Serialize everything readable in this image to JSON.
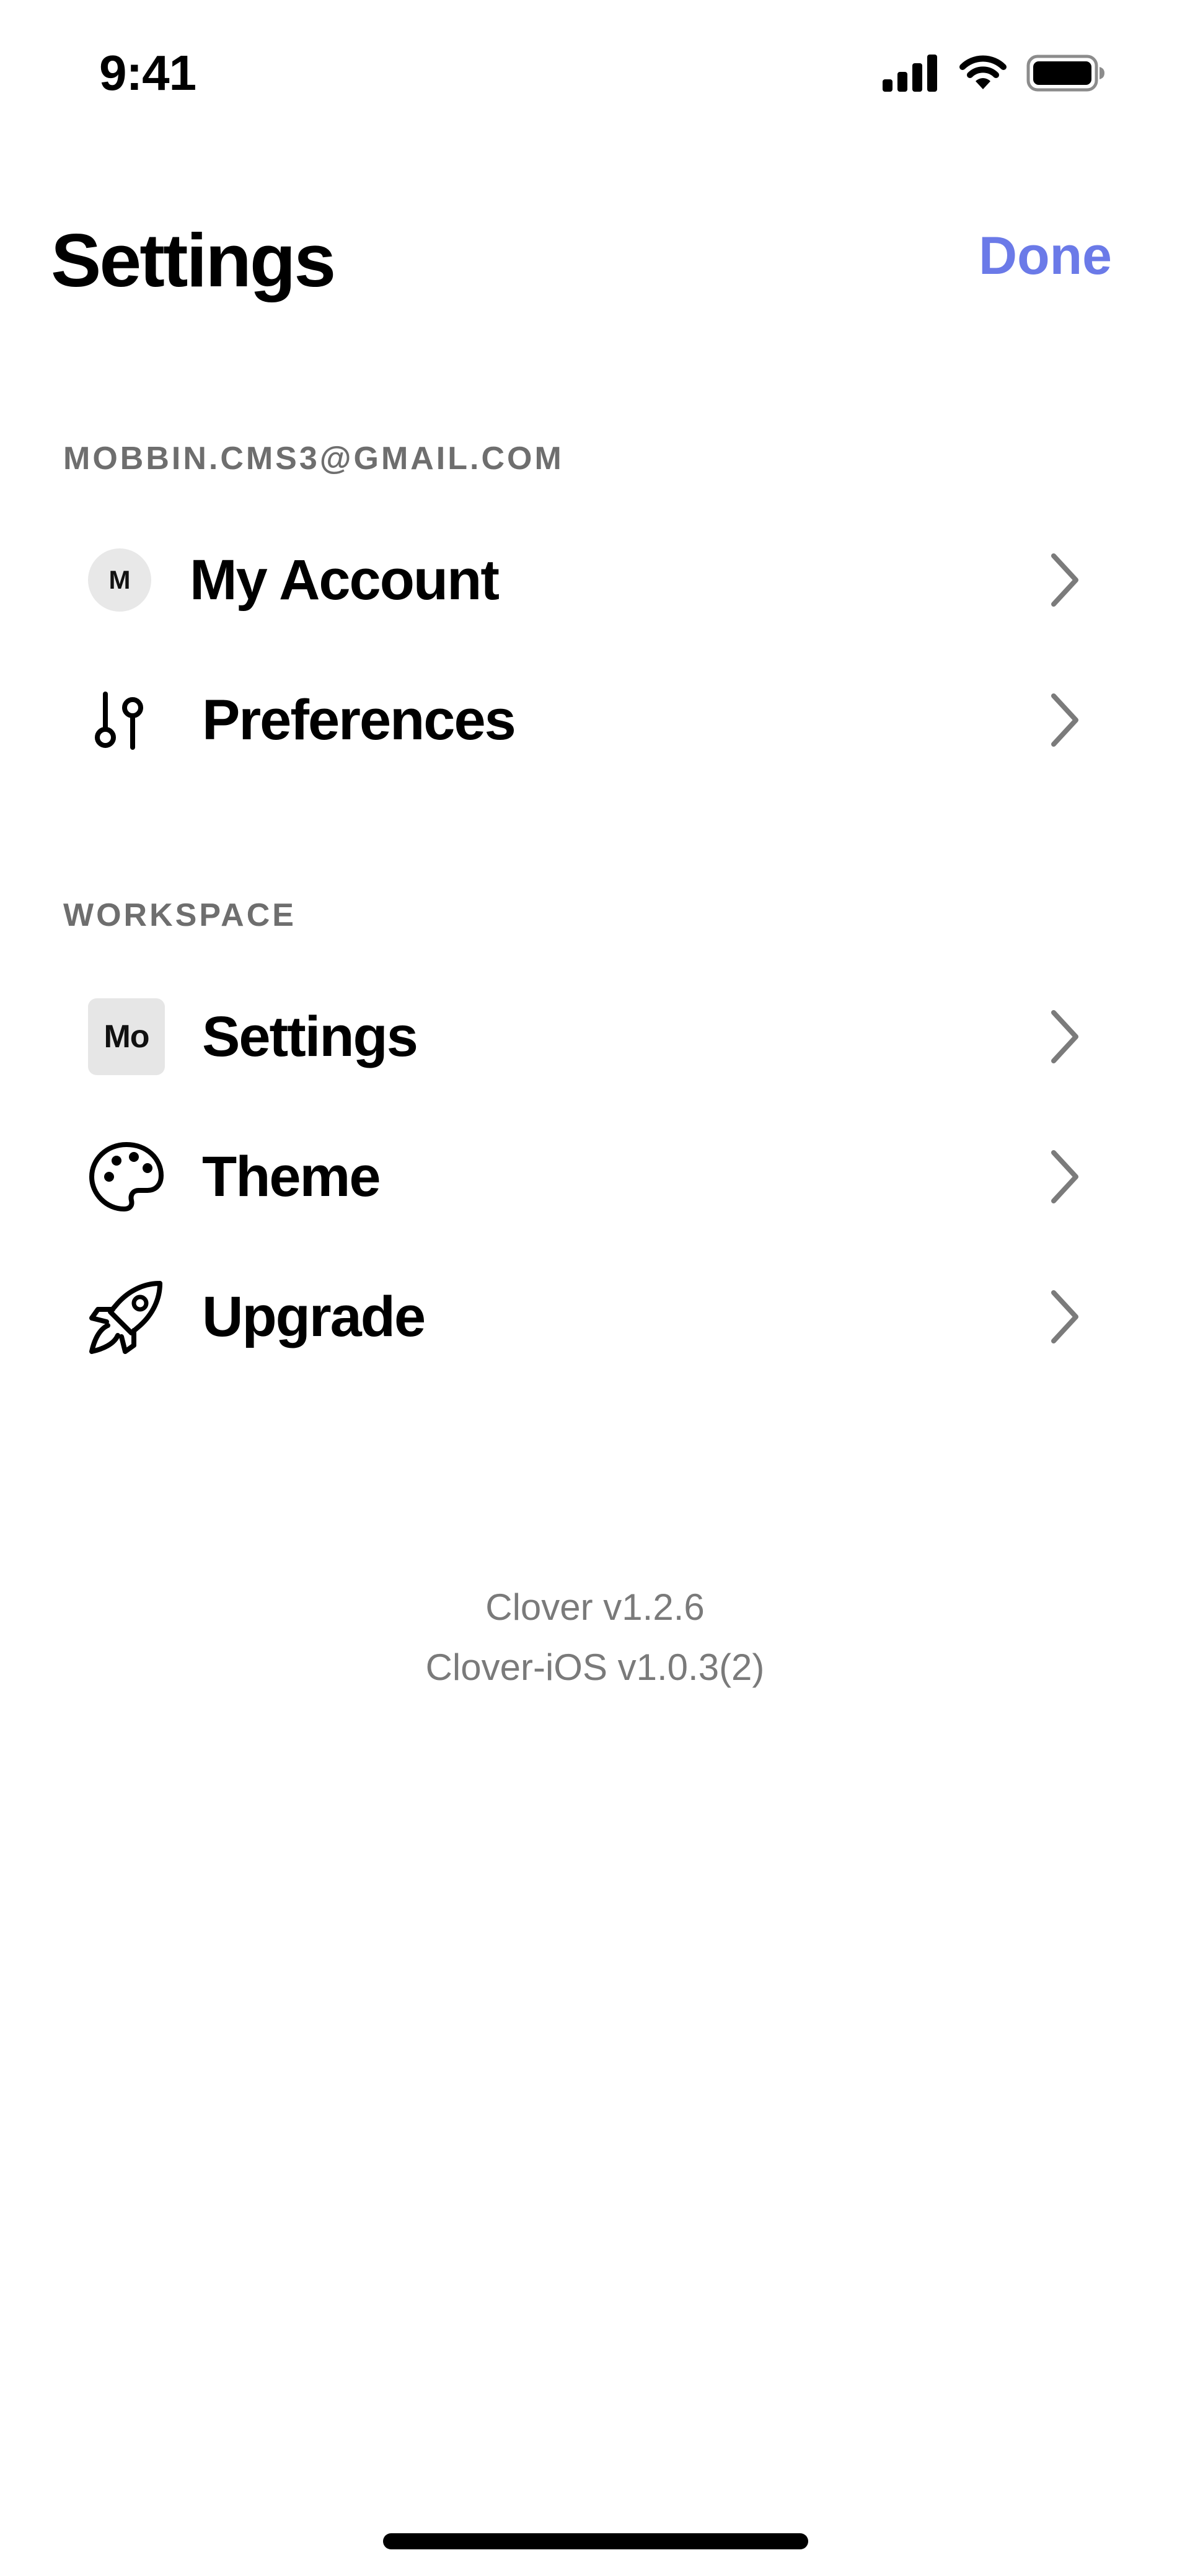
{
  "status_bar": {
    "time": "9:41",
    "icons": [
      "cellular-signal-icon",
      "wifi-icon",
      "battery-icon"
    ]
  },
  "header": {
    "title": "Settings",
    "done_label": "Done"
  },
  "account_section": {
    "header": "MOBBIN.CMS3@GMAIL.COM",
    "items": [
      {
        "label": "My Account",
        "icon": "avatar",
        "avatar_text": "M"
      },
      {
        "label": "Preferences",
        "icon": "sliders-icon"
      }
    ]
  },
  "workspace_section": {
    "header": "WORKSPACE",
    "items": [
      {
        "label": "Settings",
        "icon": "workspace-badge",
        "badge_text": "Mo"
      },
      {
        "label": "Theme",
        "icon": "palette-icon"
      },
      {
        "label": "Upgrade",
        "icon": "rocket-icon"
      }
    ]
  },
  "version": {
    "app": "Clover v1.2.6",
    "ios": "Clover-iOS v1.0.3(2)"
  },
  "colors": {
    "accent": "#6b7ae8",
    "section_header": "#6e6e6e",
    "version_text": "#7a7a7a",
    "chevron": "#7b7b7b",
    "icon_background": "#e8e8e8"
  }
}
